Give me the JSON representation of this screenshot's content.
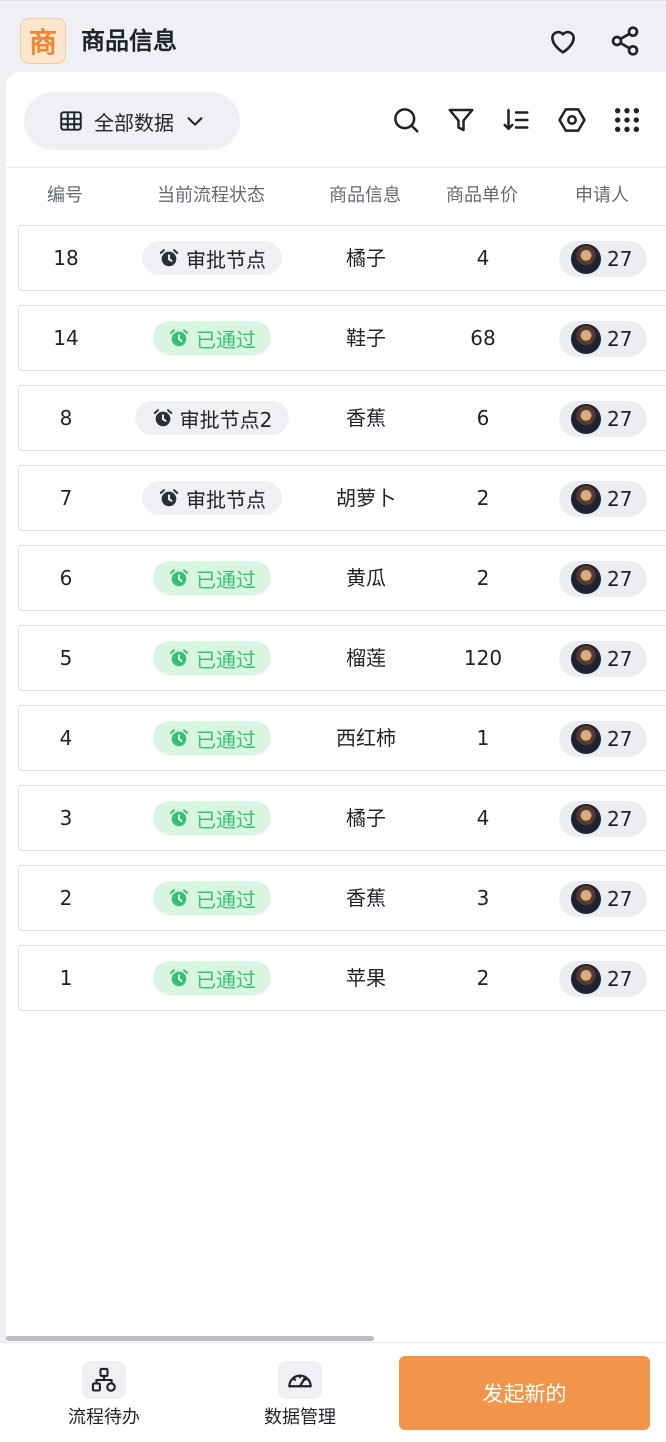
{
  "app": {
    "icon_char": "商",
    "title": "商品信息"
  },
  "toolbar": {
    "view_label": "全部数据"
  },
  "table": {
    "columns": [
      "编号",
      "当前流程状态",
      "商品信息",
      "商品单价",
      "申请人"
    ],
    "rows": [
      {
        "id": "18",
        "status": "审批节点",
        "status_type": "pending",
        "product": "橘子",
        "price": "4",
        "applicant": "27"
      },
      {
        "id": "14",
        "status": "已通过",
        "status_type": "passed",
        "product": "鞋子",
        "price": "68",
        "applicant": "27"
      },
      {
        "id": "8",
        "status": "审批节点2",
        "status_type": "pending",
        "product": "香蕉",
        "price": "6",
        "applicant": "27"
      },
      {
        "id": "7",
        "status": "审批节点",
        "status_type": "pending",
        "product": "胡萝卜",
        "price": "2",
        "applicant": "27"
      },
      {
        "id": "6",
        "status": "已通过",
        "status_type": "passed",
        "product": "黄瓜",
        "price": "2",
        "applicant": "27"
      },
      {
        "id": "5",
        "status": "已通过",
        "status_type": "passed",
        "product": "榴莲",
        "price": "120",
        "applicant": "27"
      },
      {
        "id": "4",
        "status": "已通过",
        "status_type": "passed",
        "product": "西红柿",
        "price": "1",
        "applicant": "27"
      },
      {
        "id": "3",
        "status": "已通过",
        "status_type": "passed",
        "product": "橘子",
        "price": "4",
        "applicant": "27"
      },
      {
        "id": "2",
        "status": "已通过",
        "status_type": "passed",
        "product": "香蕉",
        "price": "3",
        "applicant": "27"
      },
      {
        "id": "1",
        "status": "已通过",
        "status_type": "passed",
        "product": "苹果",
        "price": "2",
        "applicant": "27"
      }
    ]
  },
  "bottom_nav": {
    "todo_label": "流程待办",
    "data_label": "数据管理",
    "primary_label": "发起新的"
  },
  "icons": {
    "top": [
      "heart-icon",
      "share-icon"
    ],
    "toolbar": [
      "table-grid-icon",
      "chevron-down-icon",
      "search-icon",
      "filter-icon",
      "sort-icon",
      "settings-icon",
      "apps-grid-icon"
    ],
    "status": "alarm-clock-icon",
    "bottom": [
      "workflow-icon",
      "dashboard-icon"
    ]
  },
  "colors": {
    "accent": "#f0954a",
    "app_icon_bg": "#fde6cf",
    "app_icon_fg": "#f0862f",
    "passed_bg": "#d9f5e2",
    "passed_fg": "#34c46b",
    "pending_bg": "#eef0f4"
  }
}
